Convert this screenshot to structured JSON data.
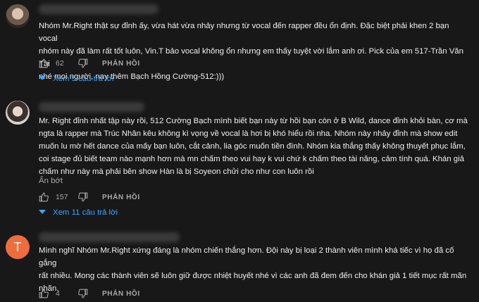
{
  "comments": [
    {
      "avatar": "avatar-photo",
      "text_lines": [
        "Nhóm Mr.Right thật sự đỉnh ấy, vừa hát vừa nhảy nhưng từ vocal đến rapper đều ổn định. Đặc biệt phải khen 2 bạn vocal",
        "nhóm này đã làm rất tốt luôn, Vin.T bảo vocal không ổn nhưng em thấy tuyệt vời lắm anh ơi. Pick của em 517-Trần Văn Tài",
        "nhé mọi người, nay thêm Bạch Hồng Cường-512:)))"
      ],
      "likes": "62",
      "reply_label": "PHẢN HỒI",
      "replies_label": "Xem 5 câu trả lời"
    },
    {
      "avatar": "avatar-photo",
      "text_lines": [
        "Mr. Right đỉnh nhất tập này rồi, 512 Cường Bạch mình biết bạn này từ hồi bạn còn ở B Wild, dance đỉnh khỏi bàn, cơ mà",
        "ngta là rapper mà Trúc Nhân kêu không kì vọng về vocal là hơi bị khó hiểu rồi nha. Nhóm này nhảy đỉnh mà show edit",
        "muốn lu mờ hết dance của mấy bạn luôn, cắt cảnh, lia góc muốn tiền đình. Nhóm kia thắng thấy không thuyết phục lắm,",
        "coi stage đủ biết team nào mạnh hơn mà mn chấm theo vui hay k vui chứ k chấm theo tài năng, cảm tính quá. Khán giả",
        "chấm như này mà phải bên show Hàn là bị Soyeon chửi cho như con luôn rồi"
      ],
      "collapse_label": "Ẩn bớt",
      "likes": "157",
      "reply_label": "PHẢN HỒI",
      "replies_label": "Xem 11 câu trả lời"
    },
    {
      "avatar_letter": "T",
      "avatar_color": "#ef6c3c",
      "text_lines": [
        "Mình nghĩ Nhóm Mr.Right xứng đáng là nhóm chiến thắng hơn. Đội này bị loại 2 thành viên mình khá tiếc vì họ đã cố gắng",
        "rất nhiều. Mong các thành viên sẽ luôn giữ được nhiệt huyết nhé vì các anh đã đem đến cho khán giả 1 tiết mục rất mãn",
        "nhãn."
      ],
      "likes": "4",
      "reply_label": "PHẢN HỒI"
    }
  ],
  "colors": {
    "background": "#181818",
    "text": "#f1f1f1",
    "muted": "#aaaaaa",
    "link": "#3ea6ff"
  }
}
